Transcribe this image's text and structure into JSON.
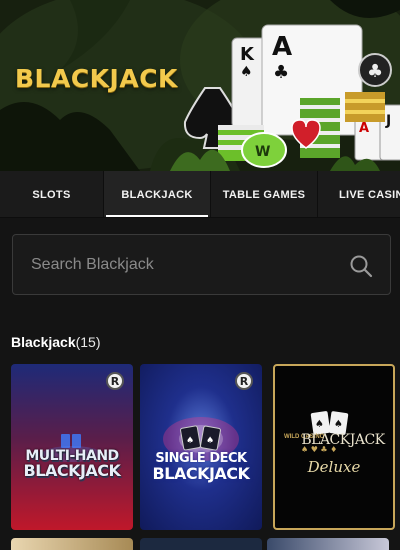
{
  "hero": {
    "title": "BLACKJACK"
  },
  "tabs": [
    {
      "label": "SLOTS",
      "active": false
    },
    {
      "label": "BLACKJACK",
      "active": true
    },
    {
      "label": "TABLE GAMES",
      "active": false
    },
    {
      "label": "LIVE CASINO",
      "active": false
    }
  ],
  "search": {
    "placeholder": "Search Blackjack",
    "icon": "search-icon"
  },
  "section": {
    "title": "Blackjack",
    "count": "(15)"
  },
  "games": [
    {
      "name_line1": "MULTI-HAND",
      "name_line2": "BLACKJACK",
      "badge": "R",
      "badge_icon": "provider-badge-icon"
    },
    {
      "name_line1": "SINGLE DECK",
      "name_line2": "BLACKJACK",
      "badge": "R",
      "badge_icon": "provider-badge-icon"
    },
    {
      "brand": "WILD CASINO",
      "name_line1": "BLACKJACK",
      "name_line2": "Deluxe"
    }
  ],
  "colors": {
    "accent_gold": "#f2c94c",
    "background": "#141414",
    "tab_bar": "#1b1b1b",
    "active_underline": "#ffffff"
  }
}
